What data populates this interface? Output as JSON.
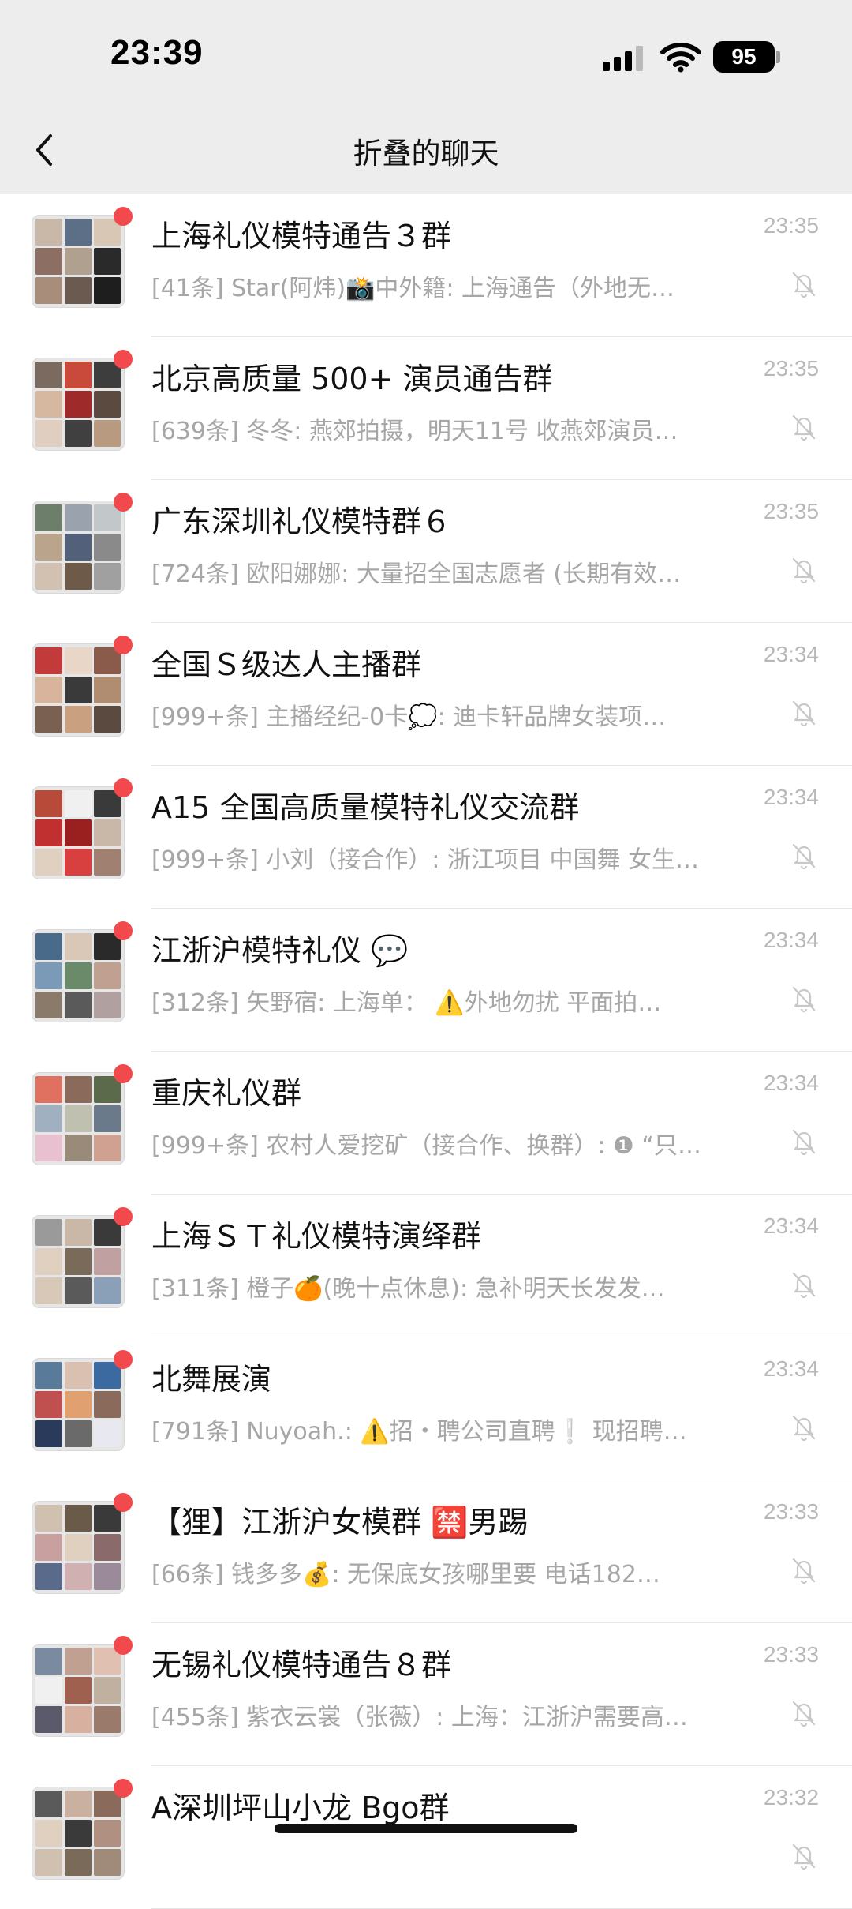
{
  "status": {
    "time": "23:39",
    "battery": "95"
  },
  "nav": {
    "title": "折叠的聊天"
  },
  "chats": [
    {
      "title": "上海礼仪模特通告３群",
      "time": "23:35",
      "preview": "[41条] Star(阿炜)📸中外籍: 上海通告（外地无…",
      "unread": true
    },
    {
      "title": "北京高质量 500+ 演员通告群",
      "time": "23:35",
      "preview": "[639条] 冬冬: 燕郊拍摄，明天11号 收燕郊演员…",
      "unread": true
    },
    {
      "title": "广东深圳礼仪模特群６",
      "time": "23:35",
      "preview": "[724条] 欧阳娜娜: 大量招全国志愿者 (长期有效…",
      "unread": true
    },
    {
      "title": "全国Ｓ级达人主播群",
      "time": "23:34",
      "preview": "[999+条] 主播经纪-0卡💭: 迪卡轩品牌女装项…",
      "unread": true
    },
    {
      "title": "A15 全国高质量模特礼仪交流群",
      "time": "23:34",
      "preview": "[999+条] 小刘（接合作）: 浙江项目 中国舞 女生…",
      "unread": true
    },
    {
      "title": "江浙沪模特礼仪 💬",
      "time": "23:34",
      "preview": "[312条] 矢野宿: 上海单：  ⚠️外地勿扰 平面拍…",
      "unread": true
    },
    {
      "title": "重庆礼仪群",
      "time": "23:34",
      "preview": "[999+条] 农村人爱挖矿（接合作、换群）: ❶ “只…",
      "unread": true
    },
    {
      "title": "上海ＳＴ礼仪模特演绎群",
      "time": "23:34",
      "preview": "[311条] 橙子🍊(晚十点休息): 急补明天长发发…",
      "unread": true
    },
    {
      "title": "北舞展演",
      "time": "23:34",
      "preview": "[791条] Nuyoah.: ⚠️招・聘公司直聘❕ 现招聘…",
      "unread": true
    },
    {
      "title": "【狸】江浙沪女模群 🈲男踢",
      "time": "23:33",
      "preview": "[66条] 钱多多💰: 无保底女孩哪里要  电话182…",
      "unread": true
    },
    {
      "title": "无锡礼仪模特通告８群",
      "time": "23:33",
      "preview": "[455条] 紫衣云裳（张薇）: 上海：江浙沪需要高…",
      "unread": true
    },
    {
      "title": "A深圳坪山小龙 Bgo群",
      "time": "23:32",
      "preview": "",
      "unread": true
    }
  ],
  "colors": {
    "unread_dot": "#f2494d",
    "nav_bg": "#ededed"
  }
}
